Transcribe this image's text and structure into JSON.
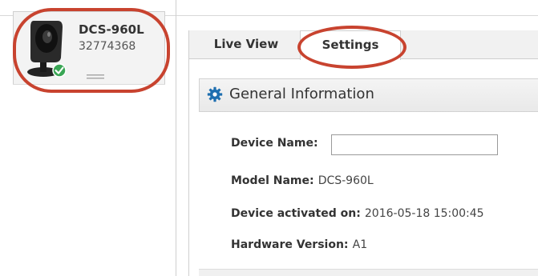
{
  "device_list": {
    "device": {
      "name": "DCS-960L",
      "id": "32774368",
      "status_icon": "check-icon",
      "icon": "camera-icon"
    }
  },
  "tabs": [
    {
      "label": "Live View",
      "selected": false
    },
    {
      "label": "Settings",
      "selected": true
    }
  ],
  "general_info": {
    "icon": "gear-icon",
    "title": "General Information",
    "device_name_label": "Device Name:",
    "device_name_value": "",
    "model_label": "Model Name:",
    "model_value": "DCS-960L",
    "activated_label": "Device activated on:",
    "activated_value": "2016-05-18 15:00:45",
    "hardware_label": "Hardware Version:",
    "hardware_value": "A1"
  },
  "colors": {
    "highlight": "#c8432f",
    "status_ok": "#3aa655",
    "gear": "#1e6fb0"
  }
}
